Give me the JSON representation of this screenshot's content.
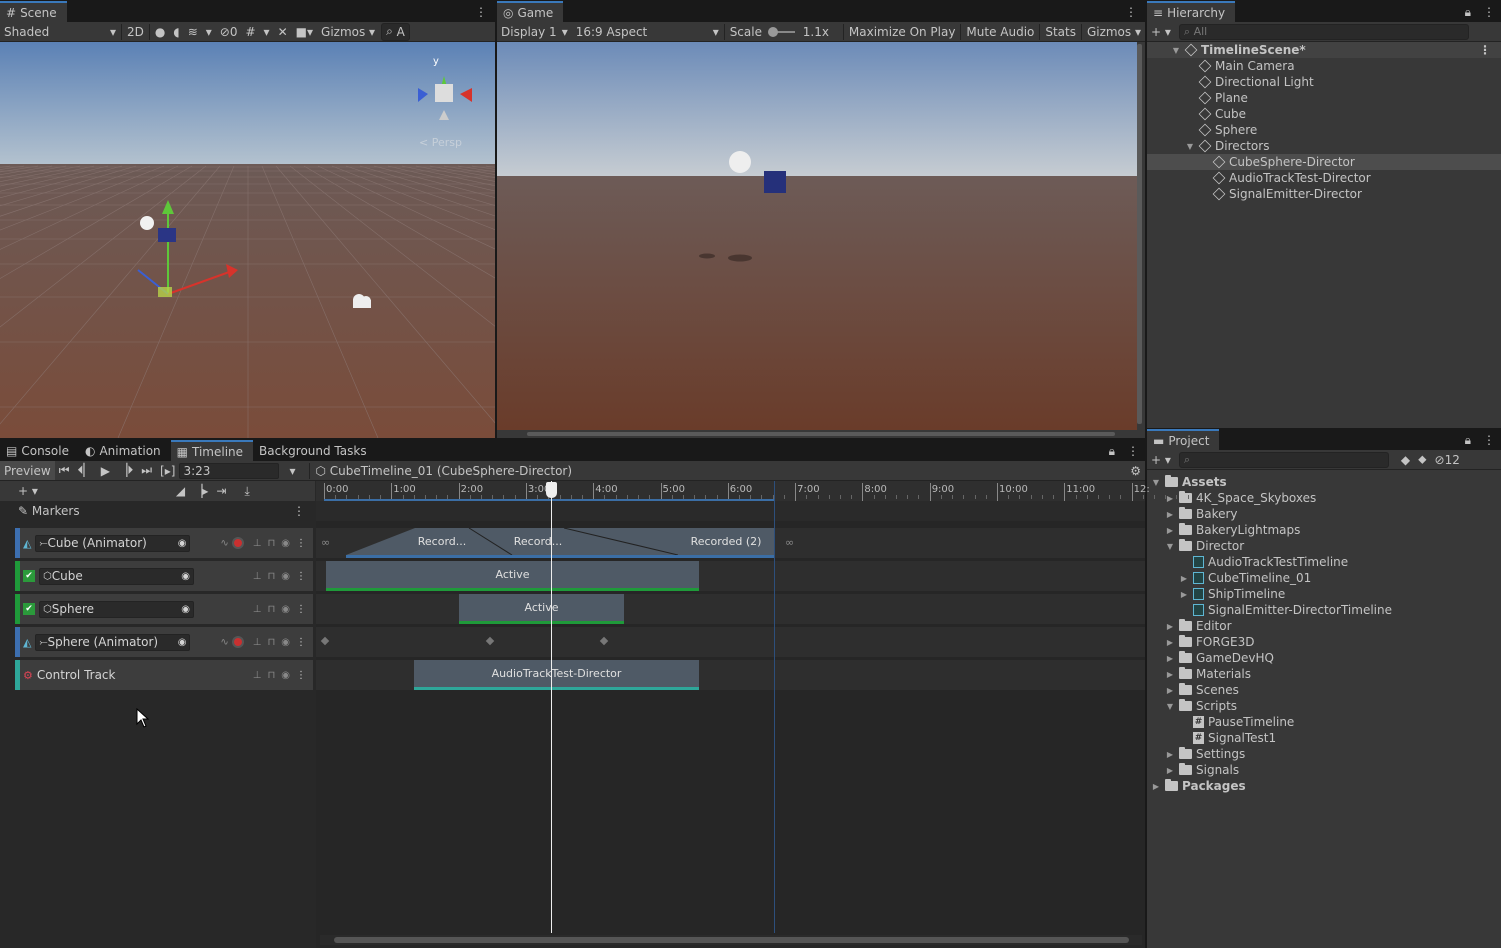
{
  "scene": {
    "tab": "Scene",
    "shading": "Shaded",
    "mode2d": "2D",
    "hidden_count": "0",
    "gizmos": "Gizmos",
    "search": "A",
    "persp": "< Persp",
    "axis_y": "y"
  },
  "game": {
    "tab": "Game",
    "display": "Display 1",
    "aspect": "16:9 Aspect",
    "scale_label": "Scale",
    "scale_value": "1.1x",
    "maximize": "Maximize On Play",
    "mute": "Mute Audio",
    "stats": "Stats",
    "gizmos": "Gizmos"
  },
  "hierarchy": {
    "tab": "Hierarchy",
    "search_placeholder": "All",
    "items": [
      {
        "label": "TimelineScene*",
        "depth": 0
      },
      {
        "label": "Main Camera",
        "depth": 1
      },
      {
        "label": "Directional Light",
        "depth": 1
      },
      {
        "label": "Plane",
        "depth": 1
      },
      {
        "label": "Cube",
        "depth": 1
      },
      {
        "label": "Sphere",
        "depth": 1
      },
      {
        "label": "Directors",
        "depth": 1
      },
      {
        "label": "CubeSphere-Director",
        "depth": 2
      },
      {
        "label": "AudioTrackTest-Director",
        "depth": 2
      },
      {
        "label": "SignalEmitter-Director",
        "depth": 2
      }
    ]
  },
  "bottom_tabs": [
    "Console",
    "Animation",
    "Timeline",
    "Background Tasks"
  ],
  "timeline": {
    "preview": "Preview",
    "time": "3:23",
    "asset": "CubeTimeline_01 (CubeSphere-Director)",
    "markers": "Markers",
    "ruler": [
      "0:00",
      "1:00",
      "2:00",
      "3:00",
      "4:00",
      "5:00",
      "6:00",
      "7:00",
      "8:00",
      "9:00",
      "10:00",
      "11:00",
      "12:"
    ],
    "tracks": [
      {
        "label": "Cube (Animator)",
        "color": "#3d6fb0"
      },
      {
        "label": "Cube",
        "color": "#1f9a3a"
      },
      {
        "label": "Sphere",
        "color": "#1f9a3a"
      },
      {
        "label": "Sphere (Animator)",
        "color": "#3d6fb0"
      },
      {
        "label": "Control Track",
        "color": "#2ea79a"
      }
    ],
    "clips": {
      "rec1": "Record...",
      "rec2": "Record...",
      "rec3": "Recorded (2)",
      "cube_active": "Active",
      "sphere_active": "Active",
      "control": "AudioTrackTest-Director"
    }
  },
  "project": {
    "tab": "Project",
    "hidden_count": "12",
    "items": [
      {
        "label": "Assets",
        "depth": 0,
        "type": "folder-open",
        "bold": true
      },
      {
        "label": "4K_Space_Skyboxes",
        "depth": 1,
        "type": "folder"
      },
      {
        "label": "Bakery",
        "depth": 1,
        "type": "folder"
      },
      {
        "label": "BakeryLightmaps",
        "depth": 1,
        "type": "folder"
      },
      {
        "label": "Director",
        "depth": 1,
        "type": "folder-open"
      },
      {
        "label": "AudioTrackTestTimeline",
        "depth": 2,
        "type": "timeline"
      },
      {
        "label": "CubeTimeline_01",
        "depth": 2,
        "type": "timeline-arrow"
      },
      {
        "label": "ShipTimeline",
        "depth": 2,
        "type": "timeline-arrow"
      },
      {
        "label": "SignalEmitter-DirectorTimeline",
        "depth": 2,
        "type": "timeline"
      },
      {
        "label": "Editor",
        "depth": 1,
        "type": "folder"
      },
      {
        "label": "FORGE3D",
        "depth": 1,
        "type": "folder"
      },
      {
        "label": "GameDevHQ",
        "depth": 1,
        "type": "folder"
      },
      {
        "label": "Materials",
        "depth": 1,
        "type": "folder"
      },
      {
        "label": "Scenes",
        "depth": 1,
        "type": "folder"
      },
      {
        "label": "Scripts",
        "depth": 1,
        "type": "folder-open"
      },
      {
        "label": "PauseTimeline",
        "depth": 2,
        "type": "script"
      },
      {
        "label": "SignalTest1",
        "depth": 2,
        "type": "script"
      },
      {
        "label": "Settings",
        "depth": 1,
        "type": "folder"
      },
      {
        "label": "Signals",
        "depth": 1,
        "type": "folder"
      },
      {
        "label": "Packages",
        "depth": 0,
        "type": "folder",
        "bold": true
      }
    ]
  }
}
